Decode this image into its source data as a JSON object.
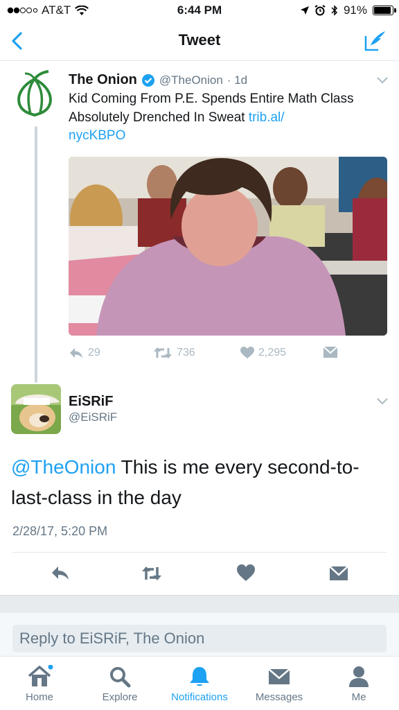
{
  "status_bar": {
    "carrier": "AT&T",
    "time": "6:44 PM",
    "battery": "91%",
    "battery_level": 0.91
  },
  "nav": {
    "title": "Tweet"
  },
  "original_tweet": {
    "name": "The Onion",
    "handle": "@TheOnion",
    "age": "· 1d",
    "text": "Kid Coming From P.E. Spends Entire Math Class Absolutely Drenched In Sweat ",
    "link": "trib.al/\nnycKBPO",
    "replies": "29",
    "retweets": "736",
    "likes": "2,295"
  },
  "reply_tweet": {
    "name": "EiSRiF",
    "handle": "@EiSRiF",
    "mention": "@TheOnion",
    "text": " This is me every second-to-last-class in the day",
    "timestamp": "2/28/17, 5:20 PM"
  },
  "reply_box": {
    "placeholder": "Reply to EiSRiF, The Onion"
  },
  "tabs": [
    {
      "label": "Home",
      "icon": "home-icon"
    },
    {
      "label": "Explore",
      "icon": "search-icon"
    },
    {
      "label": "Notifications",
      "icon": "bell-icon"
    },
    {
      "label": "Messages",
      "icon": "envelope-icon"
    },
    {
      "label": "Me",
      "icon": "person-icon"
    }
  ],
  "colors": {
    "accent": "#1da1f2",
    "onion_green": "#2e8b3a",
    "muted": "#657786",
    "action_gray": "#aab8c2"
  }
}
